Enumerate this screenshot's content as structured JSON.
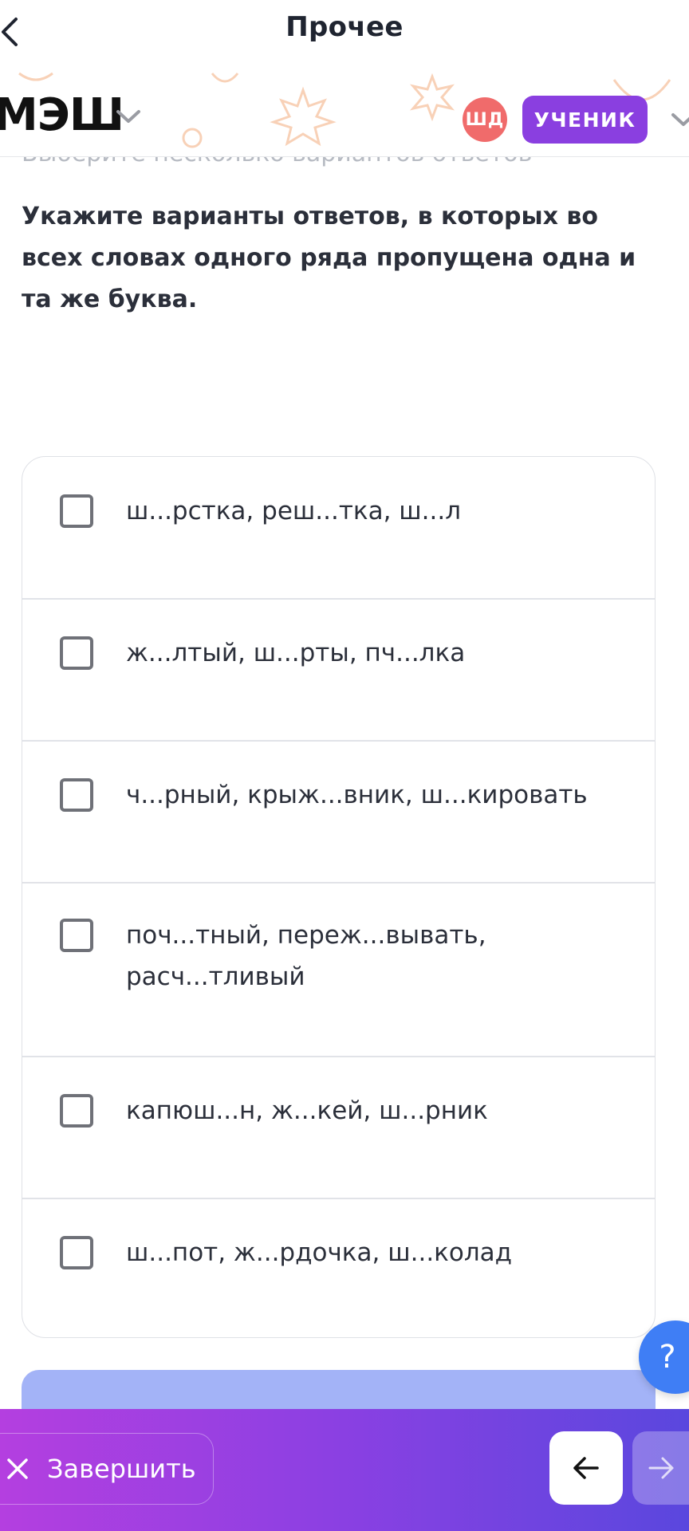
{
  "nav": {
    "title": "Прочее"
  },
  "header": {
    "logo": "МЭШ",
    "avatar_initials": "ШД",
    "role": "УЧЕНИК"
  },
  "task": {
    "hint": "Выберите несколько вариантов ответов",
    "question": "Укажите варианты ответов, в которых во всех словах одного ряда пропущена одна и та же буква."
  },
  "options": [
    {
      "text": "ш...рстка, реш...тка, ш...л",
      "checked": false
    },
    {
      "text": "ж...лтый, ш...рты, пч...лка",
      "checked": false
    },
    {
      "text": "ч...рный, крыж...вник, ш...кировать",
      "checked": false
    },
    {
      "text": "поч...тный, переж...вывать, расч...тливый",
      "checked": false
    },
    {
      "text": "капюш...н, ж...кей, ш...рник",
      "checked": false
    },
    {
      "text": "ш...пот, ж...рдочка, ш...колад",
      "checked": false
    }
  ],
  "help": {
    "label": "?"
  },
  "footer": {
    "finish_label": "Завершить"
  },
  "colors": {
    "accent": "#8a3fe0",
    "help": "#3f7ef5",
    "avatar": "#f06b6b",
    "submit": "#a3b3f7"
  }
}
